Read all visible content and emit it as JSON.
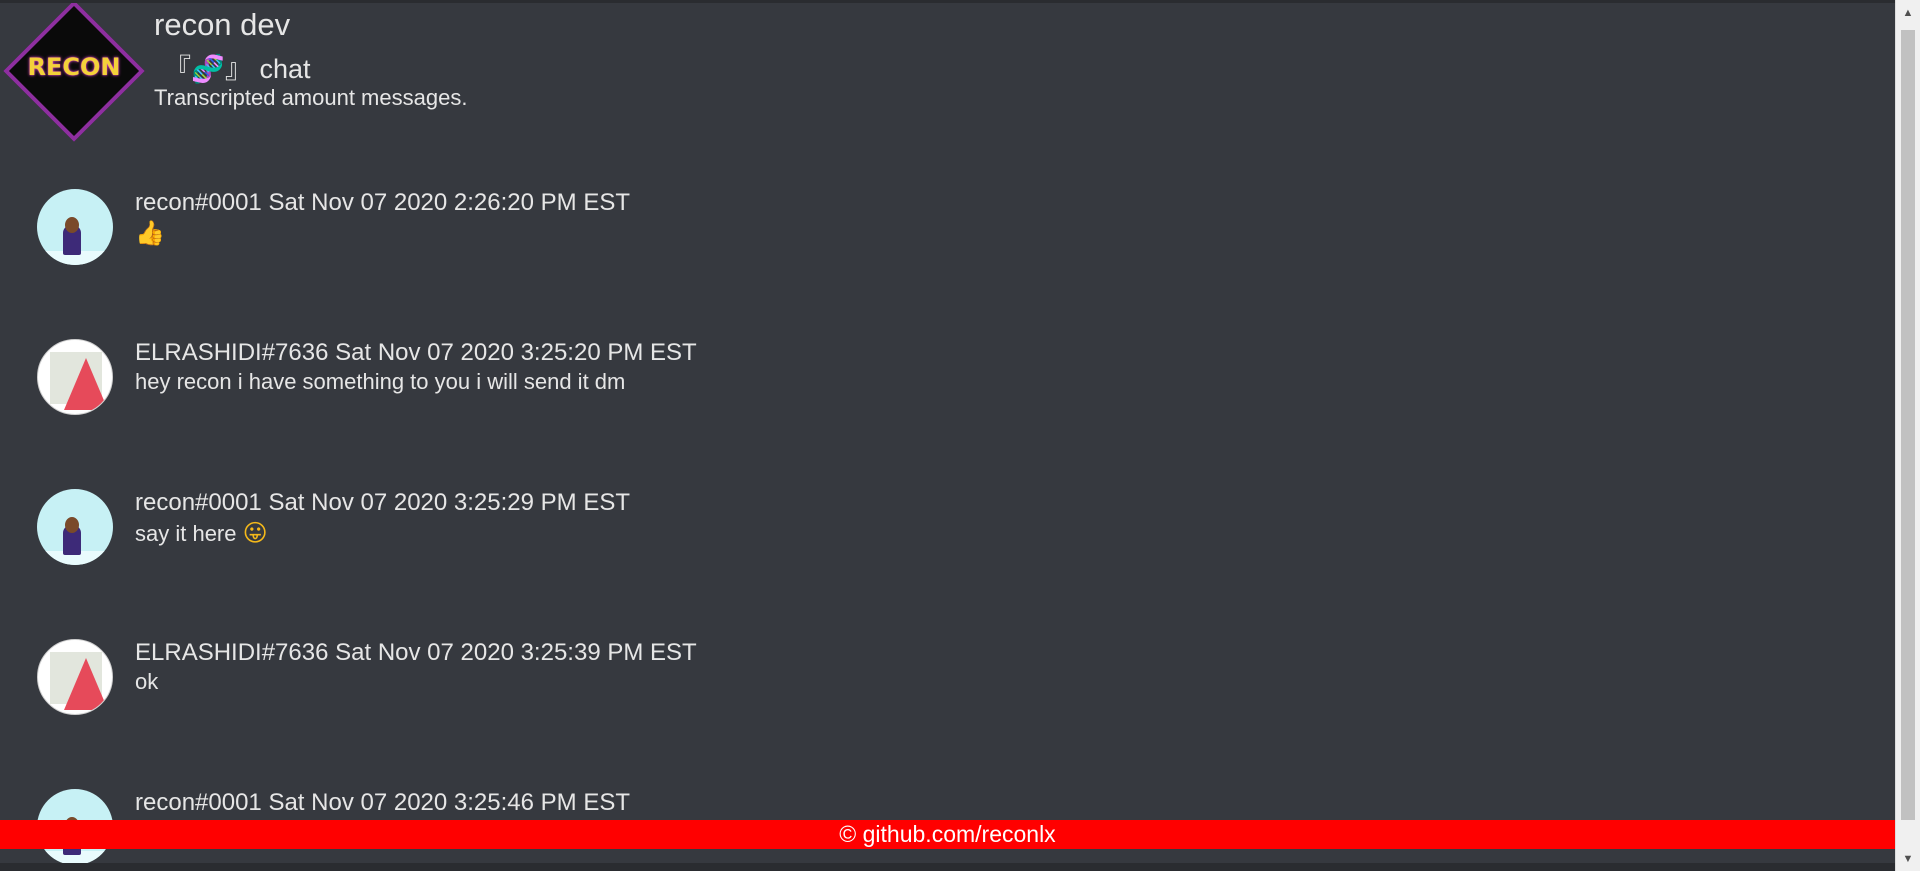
{
  "header": {
    "server_name": "recon dev",
    "server_icon_text": "RECON",
    "channel_prefix": "『",
    "channel_icon": "🧬",
    "channel_suffix": "』",
    "channel_label": " chat",
    "description": "Transcripted amount messages."
  },
  "messages": [
    {
      "author": "recon#0001",
      "timestamp": "Sat Nov 07 2020 2:26:20 PM EST",
      "content": "",
      "emoji": "👍"
    },
    {
      "author": "ELRASHIDI#7636",
      "timestamp": "Sat Nov 07 2020 3:25:20 PM EST",
      "content": "hey recon i have something to you i will send it dm",
      "emoji": ""
    },
    {
      "author": "recon#0001",
      "timestamp": "Sat Nov 07 2020 3:25:29 PM EST",
      "content": "say it here ",
      "emoji": "😛"
    },
    {
      "author": "ELRASHIDI#7636",
      "timestamp": "Sat Nov 07 2020 3:25:39 PM EST",
      "content": "ok",
      "emoji": ""
    },
    {
      "author": "recon#0001",
      "timestamp": "Sat Nov 07 2020 3:25:46 PM EST",
      "content": "",
      "emoji": ""
    }
  ],
  "footer": {
    "text": "© github.com/reconlx"
  },
  "colors": {
    "background": "#36393f",
    "footer": "#ff0000",
    "icon_border": "#8e2fa0"
  }
}
